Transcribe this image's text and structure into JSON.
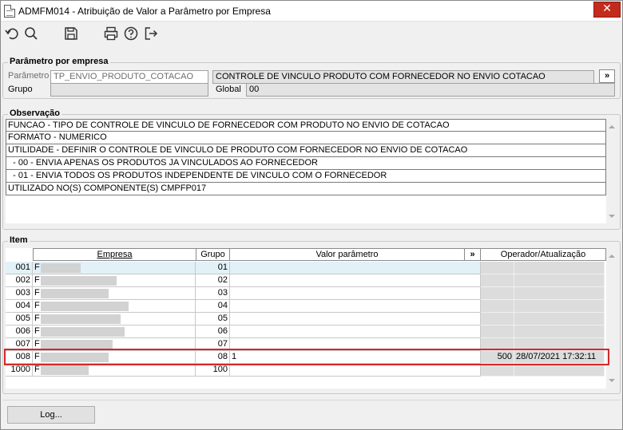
{
  "window": {
    "title": "ADMFM014 - Atribuição de Valor a Parâmetro por Empresa",
    "close_glyph": "✕"
  },
  "toolbar": {
    "icons": [
      "undo-icon",
      "search-icon",
      "save-icon",
      "print-icon",
      "help-icon",
      "exit-icon"
    ]
  },
  "parametro_group": {
    "title": "Parâmetro por empresa",
    "parametro_label": "Parâmetro",
    "parametro_value": "TP_ENVIO_PRODUTO_COTACAO",
    "descricao_value": "CONTROLE DE VINCULO PRODUTO COM FORNECEDOR NO ENVIO COTACAO",
    "more_label": "»",
    "grupo_label": "Grupo",
    "grupo_value": "",
    "global_label": "Global",
    "global_value": "00"
  },
  "observacao": {
    "title": "Observação",
    "lines": [
      "FUNCAO - TIPO DE CONTROLE DE VINCULO DE FORNECEDOR COM PRODUTO NO ENVIO DE COTACAO",
      "FORMATO - NUMERICO",
      "UTILIDADE - DEFINIR O CONTROLE DE VINCULO DE PRODUTO COM FORNECEDOR NO ENVIO DE COTACAO",
      "  - 00 - ENVIA APENAS OS PRODUTOS JA VINCULADOS AO FORNECEDOR",
      "  - 01 - ENVIA TODOS OS PRODUTOS INDEPENDENTE DE VINCULO COM O FORNECEDOR",
      "UTILIZADO NO(S) COMPONENTE(S) CMPFP017"
    ]
  },
  "item": {
    "title": "Item",
    "headers": {
      "empresa": "Empresa",
      "grupo": "Grupo",
      "valor": "Valor parâmetro",
      "more": "»",
      "operador": "Operador/Atualização"
    },
    "rows": [
      {
        "code": "001",
        "name": "F",
        "grupo": "01",
        "valor": "",
        "operador": "",
        "atualizacao": ""
      },
      {
        "code": "002",
        "name": "F",
        "grupo": "02",
        "valor": "",
        "operador": "",
        "atualizacao": ""
      },
      {
        "code": "003",
        "name": "F",
        "grupo": "03",
        "valor": "",
        "operador": "",
        "atualizacao": ""
      },
      {
        "code": "004",
        "name": "F",
        "grupo": "04",
        "valor": "",
        "operador": "",
        "atualizacao": ""
      },
      {
        "code": "005",
        "name": "F",
        "grupo": "05",
        "valor": "",
        "operador": "",
        "atualizacao": ""
      },
      {
        "code": "006",
        "name": "F",
        "grupo": "06",
        "valor": "",
        "operador": "",
        "atualizacao": ""
      },
      {
        "code": "007",
        "name": "F",
        "grupo": "07",
        "valor": "",
        "operador": "",
        "atualizacao": ""
      },
      {
        "code": "008",
        "name": "F",
        "grupo": "08",
        "valor": "1",
        "operador": "500",
        "atualizacao": "28/07/2021 17:32:11"
      },
      {
        "code": "1000",
        "name": "F",
        "grupo": "100",
        "valor": "",
        "operador": "",
        "atualizacao": ""
      }
    ]
  },
  "footer": {
    "log_label": "Log..."
  },
  "colors": {
    "highlight": "#d12a2a",
    "close_button": "#c42b1c",
    "selected_row": "#e1f1f7"
  }
}
